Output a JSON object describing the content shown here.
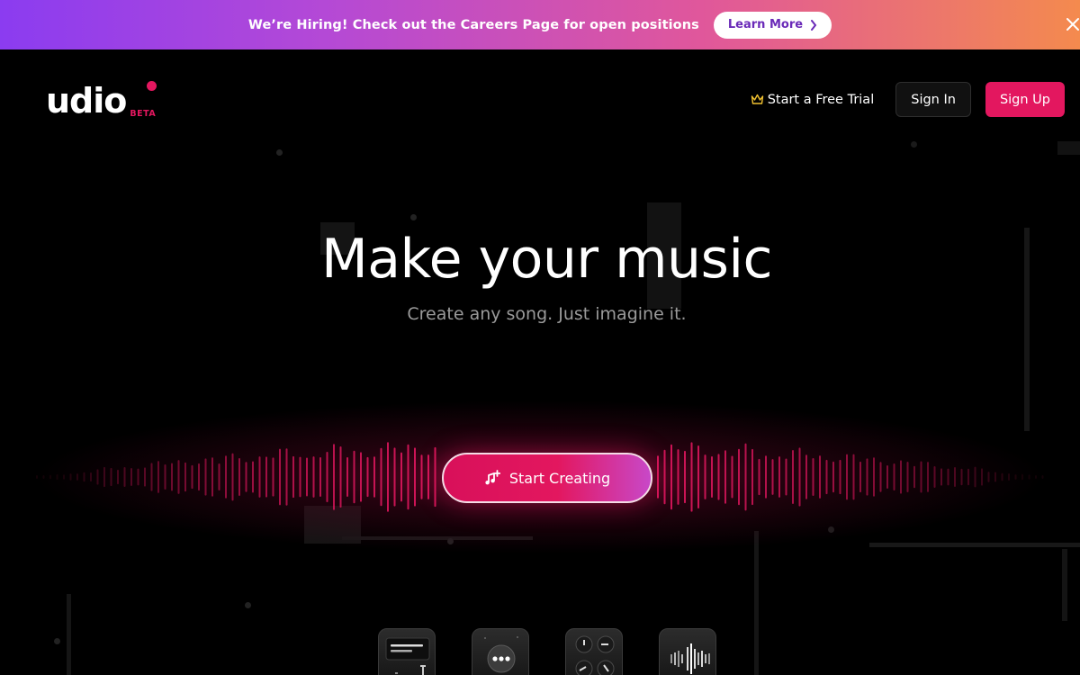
{
  "banner": {
    "text": "We’re Hiring! Check out the Careers Page for open positions",
    "button_label": "Learn More"
  },
  "logo": {
    "wordmark": "udio",
    "badge": "BETA"
  },
  "nav": {
    "trial_label": "Start a Free Trial",
    "signin_label": "Sign In",
    "signup_label": "Sign Up"
  },
  "hero": {
    "title": "Make your music",
    "subtitle": "Create any song. Just imagine it.",
    "cta_label": "Start Creating"
  },
  "feature_tiles": [
    {
      "icon": "lyrics-editor-icon"
    },
    {
      "icon": "chat-bubble-icon"
    },
    {
      "icon": "knobs-icon"
    },
    {
      "icon": "waveform-icon"
    }
  ],
  "colors": {
    "accent": "#e3175f",
    "banner_gradient_start": "#8b3cf0",
    "banner_gradient_end": "#f48a4e",
    "background": "#000000",
    "subtitle": "#9a9a9a"
  }
}
